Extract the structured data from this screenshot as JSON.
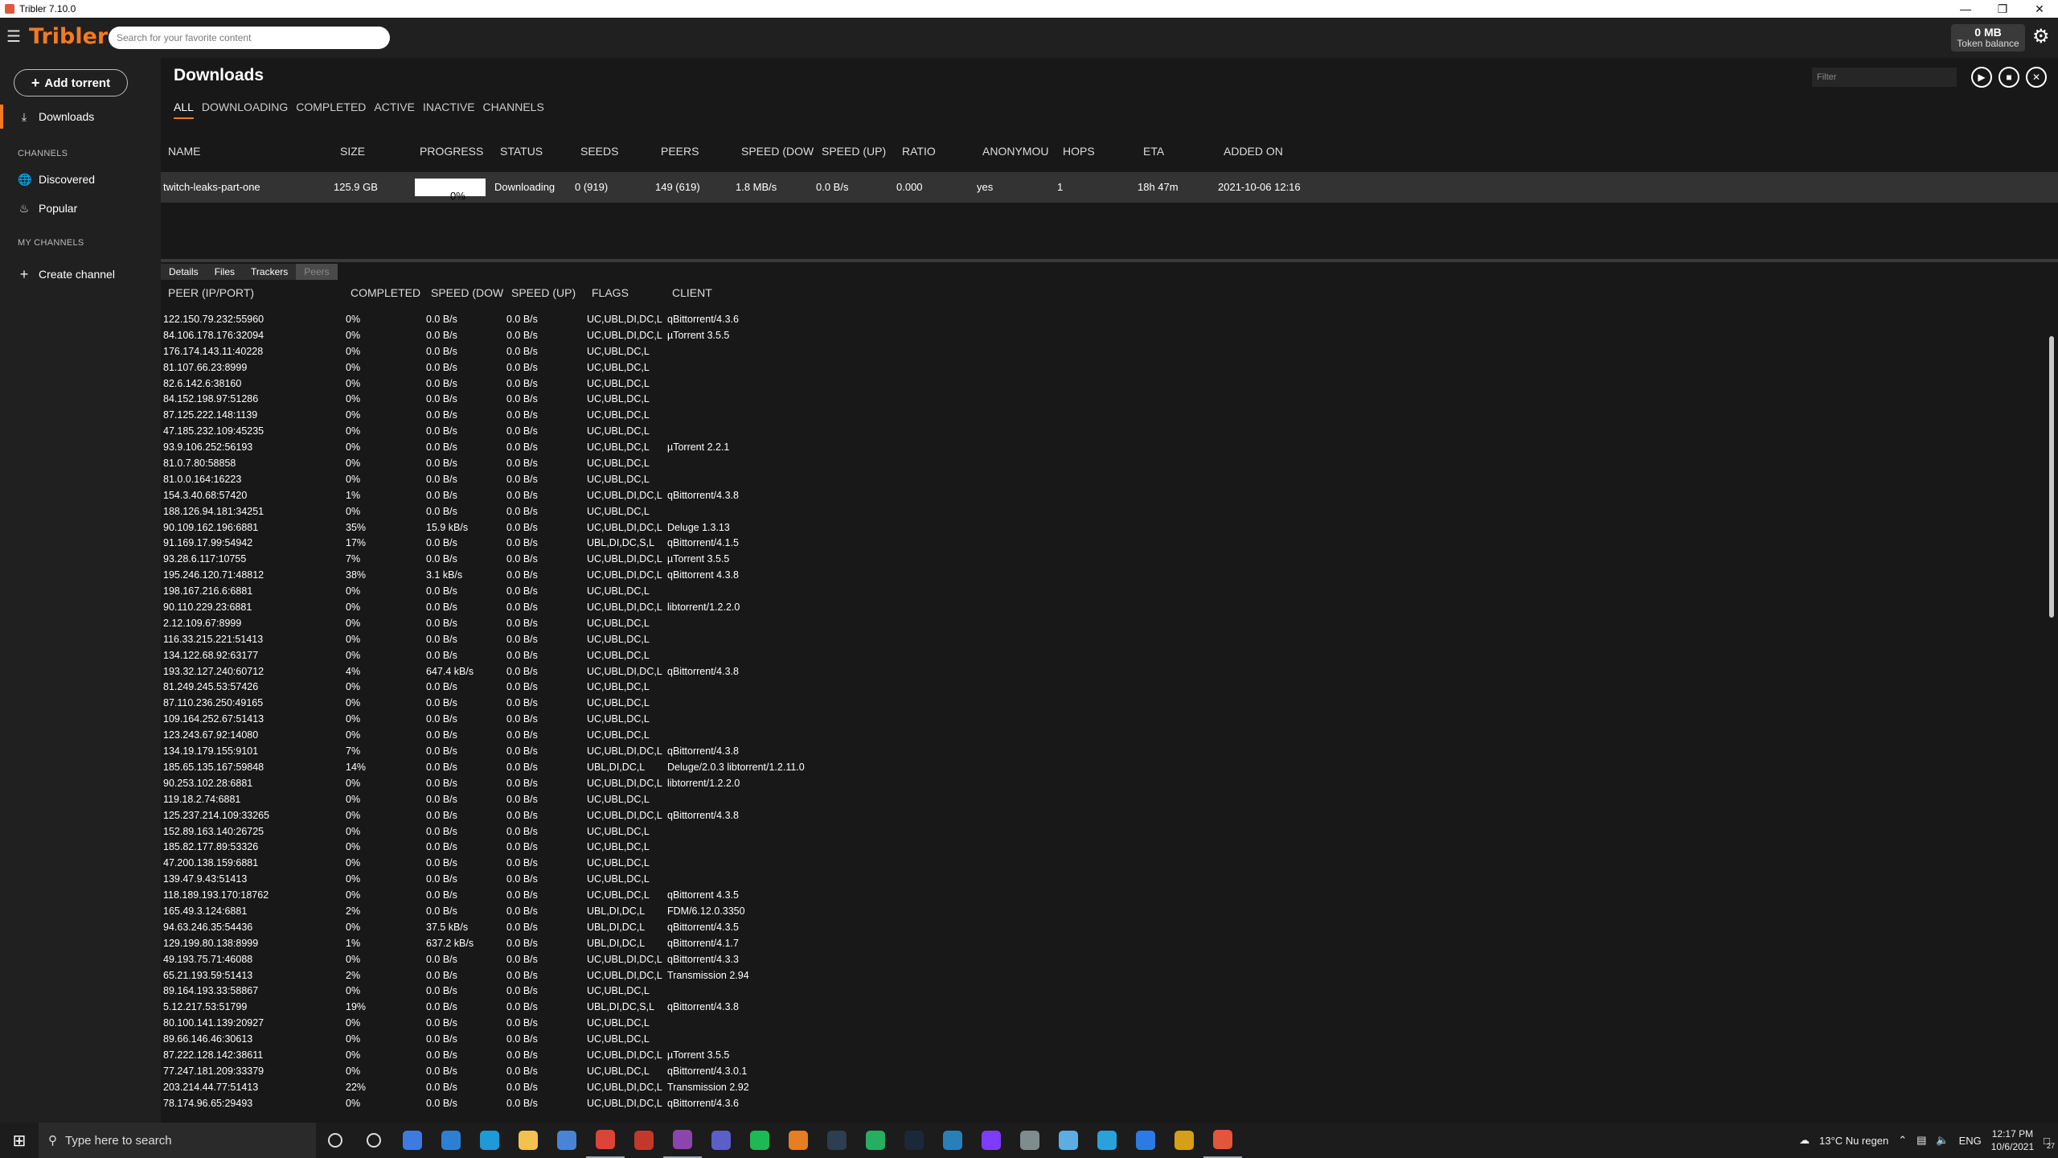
{
  "window": {
    "title": "Tribler 7.10.0"
  },
  "topbar": {
    "brand": "Tribler",
    "search_placeholder": "Search for your favorite content",
    "token_amount": "0 MB",
    "token_label": "Token balance"
  },
  "sidebar": {
    "add_torrent": "Add torrent",
    "downloads": "Downloads",
    "channels_section": "CHANNELS",
    "discovered": "Discovered",
    "popular": "Popular",
    "my_channels_section": "MY CHANNELS",
    "create_channel": "Create channel"
  },
  "main": {
    "title": "Downloads",
    "filter_placeholder": "Filter",
    "tabs": [
      "ALL",
      "DOWNLOADING",
      "COMPLETED",
      "ACTIVE",
      "INACTIVE",
      "CHANNELS"
    ],
    "active_tab": "ALL",
    "columns": [
      "NAME",
      "SIZE",
      "PROGRESS",
      "STATUS",
      "SEEDS",
      "PEERS",
      "SPEED (DOW",
      "SPEED (UP)",
      "RATIO",
      "ANONYMOU",
      "HOPS",
      "ETA",
      "ADDED ON"
    ],
    "download": {
      "name": "twitch-leaks-part-one",
      "size": "125.9 GB",
      "progress": "0%",
      "progress_fraction": 0.0,
      "status": "Downloading",
      "seeds": "0 (919)",
      "peers": "149 (619)",
      "speed_down": "1.8 MB/s",
      "speed_up": "0.0 B/s",
      "ratio": "0.000",
      "anonymous": "yes",
      "hops": "1",
      "eta": "18h 47m",
      "added_on": "2021-10-06 12:16"
    }
  },
  "details": {
    "tabs": [
      "Details",
      "Files",
      "Trackers",
      "Peers"
    ],
    "active_tab": "Peers",
    "peer_columns": [
      "PEER (IP/PORT)",
      "COMPLETED",
      "SPEED (DOW",
      "SPEED (UP)",
      "FLAGS",
      "CLIENT"
    ],
    "peers": [
      [
        "122.150.79.232:55960",
        "0%",
        "0.0 B/s",
        "0.0 B/s",
        "UC,UBL,DI,DC,L",
        "qBittorrent/4.3.6"
      ],
      [
        "84.106.178.176:32094",
        "0%",
        "0.0 B/s",
        "0.0 B/s",
        "UC,UBL,DI,DC,L",
        "µTorrent 3.5.5"
      ],
      [
        "176.174.143.11:40228",
        "0%",
        "0.0 B/s",
        "0.0 B/s",
        "UC,UBL,DC,L",
        ""
      ],
      [
        "81.107.66.23:8999",
        "0%",
        "0.0 B/s",
        "0.0 B/s",
        "UC,UBL,DC,L",
        ""
      ],
      [
        "82.6.142.6:38160",
        "0%",
        "0.0 B/s",
        "0.0 B/s",
        "UC,UBL,DC,L",
        ""
      ],
      [
        "84.152.198.97:51286",
        "0%",
        "0.0 B/s",
        "0.0 B/s",
        "UC,UBL,DC,L",
        ""
      ],
      [
        "87.125.222.148:1139",
        "0%",
        "0.0 B/s",
        "0.0 B/s",
        "UC,UBL,DC,L",
        ""
      ],
      [
        "47.185.232.109:45235",
        "0%",
        "0.0 B/s",
        "0.0 B/s",
        "UC,UBL,DC,L",
        ""
      ],
      [
        "93.9.106.252:56193",
        "0%",
        "0.0 B/s",
        "0.0 B/s",
        "UC,UBL,DC,L",
        "µTorrent 2.2.1"
      ],
      [
        "81.0.7.80:58858",
        "0%",
        "0.0 B/s",
        "0.0 B/s",
        "UC,UBL,DC,L",
        ""
      ],
      [
        "81.0.0.164:16223",
        "0%",
        "0.0 B/s",
        "0.0 B/s",
        "UC,UBL,DC,L",
        ""
      ],
      [
        "154.3.40.68:57420",
        "1%",
        "0.0 B/s",
        "0.0 B/s",
        "UC,UBL,DI,DC,L",
        "qBittorrent/4.3.8"
      ],
      [
        "188.126.94.181:34251",
        "0%",
        "0.0 B/s",
        "0.0 B/s",
        "UC,UBL,DC,L",
        ""
      ],
      [
        "90.109.162.196:6881",
        "35%",
        "15.9 kB/s",
        "0.0 B/s",
        "UC,UBL,DI,DC,L",
        "Deluge 1.3.13"
      ],
      [
        "91.169.17.99:54942",
        "17%",
        "0.0 B/s",
        "0.0 B/s",
        "UBL,DI,DC,S,L",
        "qBittorrent/4.1.5"
      ],
      [
        "93.28.6.117:10755",
        "7%",
        "0.0 B/s",
        "0.0 B/s",
        "UC,UBL,DI,DC,L",
        "µTorrent 3.5.5"
      ],
      [
        "195.246.120.71:48812",
        "38%",
        "3.1 kB/s",
        "0.0 B/s",
        "UC,UBL,DI,DC,L",
        "qBittorrent 4.3.8"
      ],
      [
        "198.167.216.6:6881",
        "0%",
        "0.0 B/s",
        "0.0 B/s",
        "UC,UBL,DC,L",
        ""
      ],
      [
        "90.110.229.23:6881",
        "0%",
        "0.0 B/s",
        "0.0 B/s",
        "UC,UBL,DI,DC,L",
        "libtorrent/1.2.2.0"
      ],
      [
        "2.12.109.67:8999",
        "0%",
        "0.0 B/s",
        "0.0 B/s",
        "UC,UBL,DC,L",
        ""
      ],
      [
        "116.33.215.221:51413",
        "0%",
        "0.0 B/s",
        "0.0 B/s",
        "UC,UBL,DC,L",
        ""
      ],
      [
        "134.122.68.92:63177",
        "0%",
        "0.0 B/s",
        "0.0 B/s",
        "UC,UBL,DC,L",
        ""
      ],
      [
        "193.32.127.240:60712",
        "4%",
        "647.4 kB/s",
        "0.0 B/s",
        "UC,UBL,DI,DC,L",
        "qBittorrent/4.3.8"
      ],
      [
        "81.249.245.53:57426",
        "0%",
        "0.0 B/s",
        "0.0 B/s",
        "UC,UBL,DC,L",
        ""
      ],
      [
        "87.110.236.250:49165",
        "0%",
        "0.0 B/s",
        "0.0 B/s",
        "UC,UBL,DC,L",
        ""
      ],
      [
        "109.164.252.67:51413",
        "0%",
        "0.0 B/s",
        "0.0 B/s",
        "UC,UBL,DC,L",
        ""
      ],
      [
        "123.243.67.92:14080",
        "0%",
        "0.0 B/s",
        "0.0 B/s",
        "UC,UBL,DC,L",
        ""
      ],
      [
        "134.19.179.155:9101",
        "7%",
        "0.0 B/s",
        "0.0 B/s",
        "UC,UBL,DI,DC,L",
        "qBittorrent/4.3.8"
      ],
      [
        "185.65.135.167:59848",
        "14%",
        "0.0 B/s",
        "0.0 B/s",
        "UBL,DI,DC,L",
        "Deluge/2.0.3 libtorrent/1.2.11.0"
      ],
      [
        "90.253.102.28:6881",
        "0%",
        "0.0 B/s",
        "0.0 B/s",
        "UC,UBL,DI,DC,L",
        "libtorrent/1.2.2.0"
      ],
      [
        "119.18.2.74:6881",
        "0%",
        "0.0 B/s",
        "0.0 B/s",
        "UC,UBL,DC,L",
        ""
      ],
      [
        "125.237.214.109:33265",
        "0%",
        "0.0 B/s",
        "0.0 B/s",
        "UC,UBL,DI,DC,L",
        "qBittorrent/4.3.8"
      ],
      [
        "152.89.163.140:26725",
        "0%",
        "0.0 B/s",
        "0.0 B/s",
        "UC,UBL,DC,L",
        ""
      ],
      [
        "185.82.177.89:53326",
        "0%",
        "0.0 B/s",
        "0.0 B/s",
        "UC,UBL,DC,L",
        ""
      ],
      [
        "47.200.138.159:6881",
        "0%",
        "0.0 B/s",
        "0.0 B/s",
        "UC,UBL,DC,L",
        ""
      ],
      [
        "139.47.9.43:51413",
        "0%",
        "0.0 B/s",
        "0.0 B/s",
        "UC,UBL,DC,L",
        ""
      ],
      [
        "118.189.193.170:18762",
        "0%",
        "0.0 B/s",
        "0.0 B/s",
        "UC,UBL,DC,L",
        "qBittorrent 4.3.5"
      ],
      [
        "165.49.3.124:6881",
        "2%",
        "0.0 B/s",
        "0.0 B/s",
        "UBL,DI,DC,L",
        "FDM/6.12.0.3350"
      ],
      [
        "94.63.246.35:54436",
        "0%",
        "37.5 kB/s",
        "0.0 B/s",
        "UBL,DI,DC,L",
        "qBittorrent/4.3.5"
      ],
      [
        "129.199.80.138:8999",
        "1%",
        "637.2 kB/s",
        "0.0 B/s",
        "UBL,DI,DC,L",
        "qBittorrent/4.1.7"
      ],
      [
        "49.193.75.71:46088",
        "0%",
        "0.0 B/s",
        "0.0 B/s",
        "UC,UBL,DI,DC,L",
        "qBittorrent/4.3.3"
      ],
      [
        "65.21.193.59:51413",
        "2%",
        "0.0 B/s",
        "0.0 B/s",
        "UC,UBL,DI,DC,L",
        "Transmission 2.94"
      ],
      [
        "89.164.193.33:58867",
        "0%",
        "0.0 B/s",
        "0.0 B/s",
        "UC,UBL,DC,L",
        ""
      ],
      [
        "5.12.217.53:51799",
        "19%",
        "0.0 B/s",
        "0.0 B/s",
        "UBL,DI,DC,S,L",
        "qBittorrent/4.3.8"
      ],
      [
        "80.100.141.139:20927",
        "0%",
        "0.0 B/s",
        "0.0 B/s",
        "UC,UBL,DC,L",
        ""
      ],
      [
        "89.66.146.46:30613",
        "0%",
        "0.0 B/s",
        "0.0 B/s",
        "UC,UBL,DC,L",
        ""
      ],
      [
        "87.222.128.142:38611",
        "0%",
        "0.0 B/s",
        "0.0 B/s",
        "UC,UBL,DI,DC,L",
        "µTorrent 3.5.5"
      ],
      [
        "77.247.181.209:33379",
        "0%",
        "0.0 B/s",
        "0.0 B/s",
        "UC,UBL,DC,L",
        "qBittorrent/4.3.0.1"
      ],
      [
        "203.214.44.77:51413",
        "22%",
        "0.0 B/s",
        "0.0 B/s",
        "UC,UBL,DI,DC,L",
        "Transmission 2.92"
      ],
      [
        "78.174.96.65:29493",
        "0%",
        "0.0 B/s",
        "0.0 B/s",
        "UC,UBL,DI,DC,L",
        "qBittorrent/4.3.6"
      ]
    ]
  },
  "taskbar": {
    "search_placeholder": "Type here to search",
    "weather": "13°C  Nu regen",
    "language": "ENG",
    "time": "12:17 PM",
    "date": "10/6/2021",
    "notification_count": "27",
    "apps": [
      {
        "name": "cortana-icon",
        "color": "#1c1c1c"
      },
      {
        "name": "task-view-icon",
        "color": "#1c1c1c"
      },
      {
        "name": "chrome-alt-icon",
        "color": "#3d7be0"
      },
      {
        "name": "mail-icon",
        "color": "#2d7fd2"
      },
      {
        "name": "edge-icon",
        "color": "#1e9ad6"
      },
      {
        "name": "file-explorer-icon",
        "color": "#f2c14e"
      },
      {
        "name": "store-icon",
        "color": "#4a84d4"
      },
      {
        "name": "chrome-icon",
        "color": "#db4437"
      },
      {
        "name": "app-tree-icon",
        "color": "#c0392b"
      },
      {
        "name": "vpn-icon",
        "color": "#8e44ad"
      },
      {
        "name": "teams-icon",
        "color": "#5b5fc7"
      },
      {
        "name": "spotify-icon",
        "color": "#1db954"
      },
      {
        "name": "shield-app-icon",
        "color": "#e67e22"
      },
      {
        "name": "dark-app-icon",
        "color": "#2c3e50"
      },
      {
        "name": "play-app-icon",
        "color": "#27ae60"
      },
      {
        "name": "steam-icon",
        "color": "#1b2838"
      },
      {
        "name": "cloud-app-icon",
        "color": "#2980b9"
      },
      {
        "name": "lightning-app-icon",
        "color": "#7d3cff"
      },
      {
        "name": "settings-app-icon",
        "color": "#7f8c8d"
      },
      {
        "name": "notes-app-icon",
        "color": "#5dade2"
      },
      {
        "name": "telegram-icon",
        "color": "#2aa1da"
      },
      {
        "name": "onedrive-icon",
        "color": "#2c7be5"
      },
      {
        "name": "photos-icon",
        "color": "#d4a017"
      },
      {
        "name": "tribler-taskbar-icon",
        "color": "#e3563b"
      }
    ]
  },
  "colors": {
    "accent": "#f27b22",
    "background": "#181818",
    "sidebar": "#202020",
    "row_selected": "#333333"
  }
}
